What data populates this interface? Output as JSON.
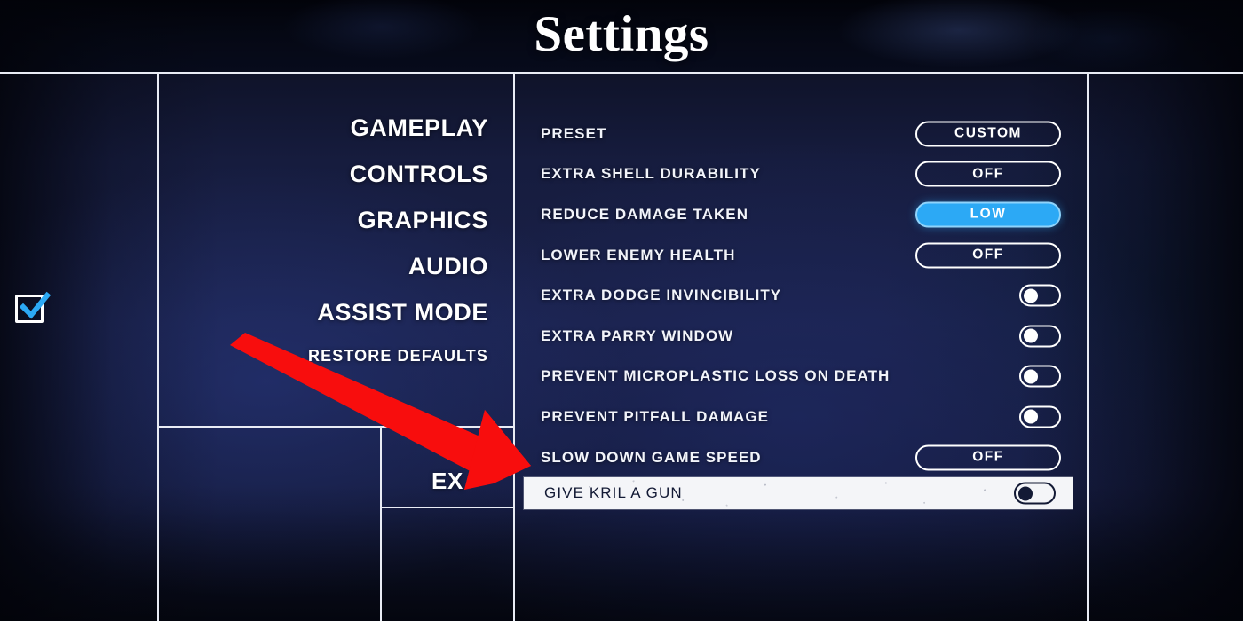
{
  "header": {
    "title": "Settings"
  },
  "sidebar": {
    "items": [
      {
        "label": "GAMEPLAY",
        "size": "large",
        "checked": false
      },
      {
        "label": "CONTROLS",
        "size": "large",
        "checked": false
      },
      {
        "label": "GRAPHICS",
        "size": "large",
        "checked": false
      },
      {
        "label": "AUDIO",
        "size": "large",
        "checked": false
      },
      {
        "label": "ASSIST MODE",
        "size": "large",
        "checked": true
      },
      {
        "label": "RESTORE DEFAULTS",
        "size": "small",
        "checked": false
      }
    ],
    "checkbox_color": "#2ca9f5",
    "bottom_panel_label": "EX"
  },
  "settings": {
    "rows": [
      {
        "label": "PRESET",
        "control": "pill",
        "value": "CUSTOM",
        "active": false,
        "highlighted": false
      },
      {
        "label": "EXTRA SHELL DURABILITY",
        "control": "pill",
        "value": "OFF",
        "active": false,
        "highlighted": false
      },
      {
        "label": "REDUCE DAMAGE TAKEN",
        "control": "pill",
        "value": "LOW",
        "active": true,
        "highlighted": false
      },
      {
        "label": "LOWER ENEMY HEALTH",
        "control": "pill",
        "value": "OFF",
        "active": false,
        "highlighted": false
      },
      {
        "label": "EXTRA DODGE INVINCIBILITY",
        "control": "toggle",
        "value": "off",
        "active": false,
        "highlighted": false
      },
      {
        "label": "EXTRA PARRY WINDOW",
        "control": "toggle",
        "value": "off",
        "active": false,
        "highlighted": false
      },
      {
        "label": "PREVENT MICROPLASTIC LOSS ON DEATH",
        "control": "toggle",
        "value": "off",
        "active": false,
        "highlighted": false
      },
      {
        "label": "PREVENT PITFALL DAMAGE",
        "control": "toggle",
        "value": "off",
        "active": false,
        "highlighted": false
      },
      {
        "label": "SLOW DOWN GAME SPEED",
        "control": "pill",
        "value": "OFF",
        "active": false,
        "highlighted": false
      },
      {
        "label": "GIVE KRIL A GUN",
        "control": "toggle",
        "value": "off",
        "active": false,
        "highlighted": true
      }
    ]
  },
  "annotation": {
    "arrow_color": "#f80d0d",
    "points_to": "GIVE KRIL A GUN"
  },
  "colors": {
    "accent_blue": "#2ca9f5",
    "panel_line": "#e9ecf5",
    "background_navy": "#1a2149",
    "highlight_row": "#f4f5f8",
    "text_primary": "#ffffff"
  }
}
